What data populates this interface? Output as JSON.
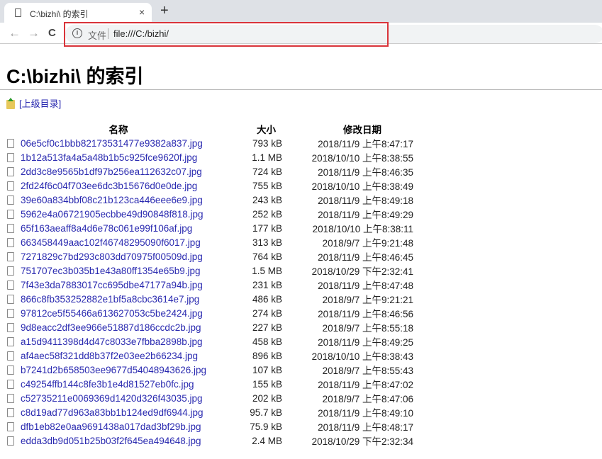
{
  "browser": {
    "tab_title": "C:\\bizhi\\ 的索引",
    "new_tab": "+",
    "close": "×",
    "back": "←",
    "forward": "→",
    "reload": "C",
    "info_icon": "i",
    "scheme_label": "文件",
    "url": "file:///C:/bizhi/"
  },
  "page": {
    "heading": "C:\\bizhi\\ 的索引",
    "parent_link": "[上级目录]"
  },
  "table": {
    "headers": {
      "name": "名称",
      "size": "大小",
      "date": "修改日期"
    },
    "rows": [
      {
        "name": "06e5cf0c1bbb82173531477e9382a837.jpg",
        "size": "793 kB",
        "date": "2018/11/9 上午8:47:17"
      },
      {
        "name": "1b12a513fa4a5a48b1b5c925fce9620f.jpg",
        "size": "1.1 MB",
        "date": "2018/10/10 上午8:38:55"
      },
      {
        "name": "2dd3c8e9565b1df97b256ea112632c07.jpg",
        "size": "724 kB",
        "date": "2018/11/9 上午8:46:35"
      },
      {
        "name": "2fd24f6c04f703ee6dc3b15676d0e0de.jpg",
        "size": "755 kB",
        "date": "2018/10/10 上午8:38:49"
      },
      {
        "name": "39e60a834bbf08c21b123ca446eee6e9.jpg",
        "size": "243 kB",
        "date": "2018/11/9 上午8:49:18"
      },
      {
        "name": "5962e4a06721905ecbbe49d90848f818.jpg",
        "size": "252 kB",
        "date": "2018/11/9 上午8:49:29"
      },
      {
        "name": "65f163aeaff8a4d6e78c061e99f106af.jpg",
        "size": "177 kB",
        "date": "2018/10/10 上午8:38:11"
      },
      {
        "name": "663458449aac102f46748295090f6017.jpg",
        "size": "313 kB",
        "date": "2018/9/7 上午9:21:48"
      },
      {
        "name": "7271829c7bd293c803dd70975f00509d.jpg",
        "size": "764 kB",
        "date": "2018/11/9 上午8:46:45"
      },
      {
        "name": "751707ec3b035b1e43a80ff1354e65b9.jpg",
        "size": "1.5 MB",
        "date": "2018/10/29 下午2:32:41"
      },
      {
        "name": "7f43e3da7883017cc695dbe47177a94b.jpg",
        "size": "231 kB",
        "date": "2018/11/9 上午8:47:48"
      },
      {
        "name": "866c8fb353252882e1bf5a8cbc3614e7.jpg",
        "size": "486 kB",
        "date": "2018/9/7 上午9:21:21"
      },
      {
        "name": "97812ce5f55466a613627053c5be2424.jpg",
        "size": "274 kB",
        "date": "2018/11/9 上午8:46:56"
      },
      {
        "name": "9d8eacc2df3ee966e51887d186ccdc2b.jpg",
        "size": "227 kB",
        "date": "2018/9/7 上午8:55:18"
      },
      {
        "name": "a15d9411398d4d47c8033e7fbba2898b.jpg",
        "size": "458 kB",
        "date": "2018/11/9 上午8:49:25"
      },
      {
        "name": "af4aec58f321dd8b37f2e03ee2b66234.jpg",
        "size": "896 kB",
        "date": "2018/10/10 上午8:38:43"
      },
      {
        "name": "b7241d2b658503ee9677d54048943626.jpg",
        "size": "107 kB",
        "date": "2018/9/7 上午8:55:43"
      },
      {
        "name": "c49254ffb144c8fe3b1e4d81527eb0fc.jpg",
        "size": "155 kB",
        "date": "2018/11/9 上午8:47:02"
      },
      {
        "name": "c52735211e0069369d1420d326f43035.jpg",
        "size": "202 kB",
        "date": "2018/9/7 上午8:47:06"
      },
      {
        "name": "c8d19ad77d963a83bb1b124ed9df6944.jpg",
        "size": "95.7 kB",
        "date": "2018/11/9 上午8:49:10"
      },
      {
        "name": "dfb1eb82e0aa9691438a017dad3bf29b.jpg",
        "size": "75.9 kB",
        "date": "2018/11/9 上午8:48:17"
      },
      {
        "name": "edda3db9d051b25b03f2f645ea494648.jpg",
        "size": "2.4 MB",
        "date": "2018/10/29 下午2:32:34"
      }
    ]
  }
}
